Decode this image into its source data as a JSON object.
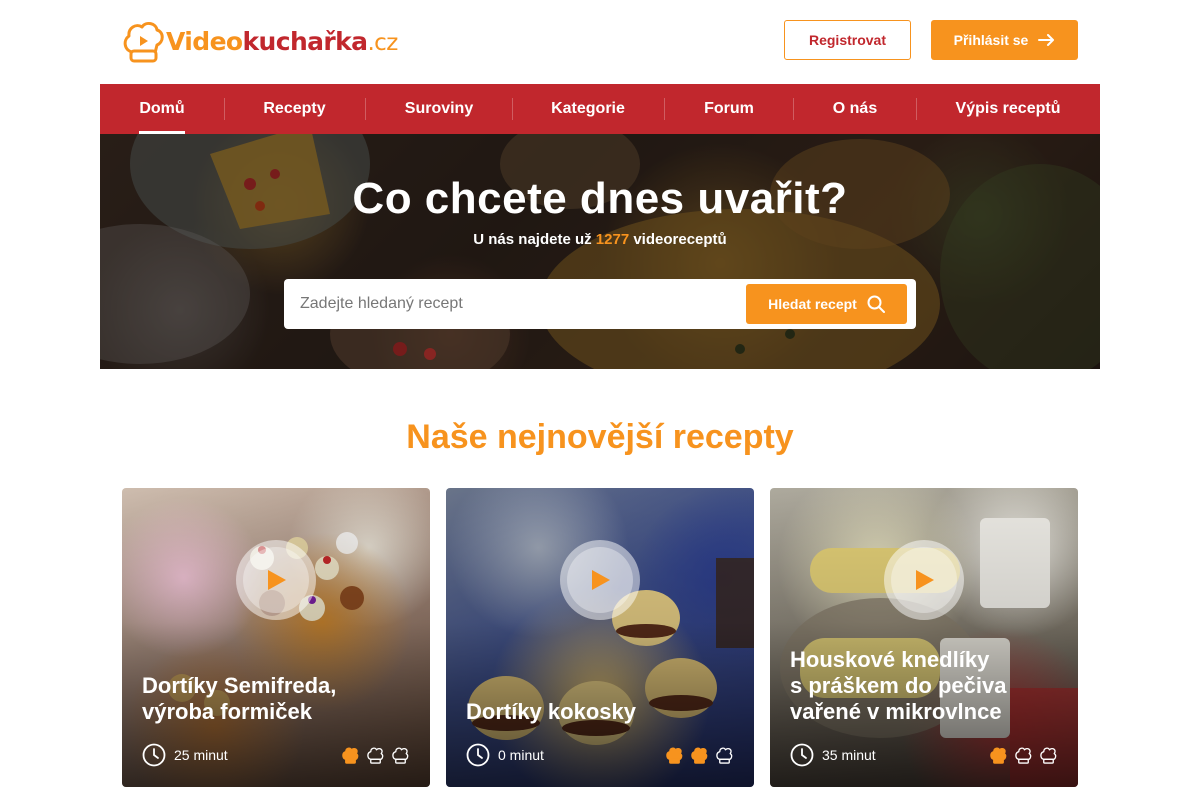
{
  "brand": {
    "name_part1": "Video",
    "name_part2": "kuchařka",
    "name_part3": ".cz",
    "orange": "#f7931e",
    "red": "#c1272d"
  },
  "header": {
    "register_label": "Registrovat",
    "login_label": "Přihlásit se"
  },
  "nav": {
    "items": [
      {
        "label": "Domů",
        "active": true
      },
      {
        "label": "Recepty"
      },
      {
        "label": "Suroviny"
      },
      {
        "label": "Kategorie"
      },
      {
        "label": "Forum"
      },
      {
        "label": "O nás"
      },
      {
        "label": "Výpis receptů"
      }
    ]
  },
  "hero": {
    "title": "Co chcete dnes uvařit?",
    "subtitle_prefix": "U nás najdete už",
    "recipe_count": "1277",
    "subtitle_suffix": "videoreceptů",
    "search_placeholder": "Zadejte hledaný recept",
    "search_button": "Hledat recept"
  },
  "recipes_section": {
    "title": "Naše nejnovější recepty",
    "cards": [
      {
        "title_lines": [
          "Dortíky Semifreda,",
          "výroba formiček"
        ],
        "time": "25 minut",
        "difficulty": 1,
        "difficulty_max": 3
      },
      {
        "title_lines": [
          "Dortíky kokosky"
        ],
        "time": "0 minut",
        "difficulty": 2,
        "difficulty_max": 3
      },
      {
        "title_lines": [
          "Houskové knedlíky",
          "s práškem do pečiva",
          "vařené v mikrovlnce"
        ],
        "time": "35 minut",
        "difficulty": 1,
        "difficulty_max": 3
      }
    ]
  }
}
